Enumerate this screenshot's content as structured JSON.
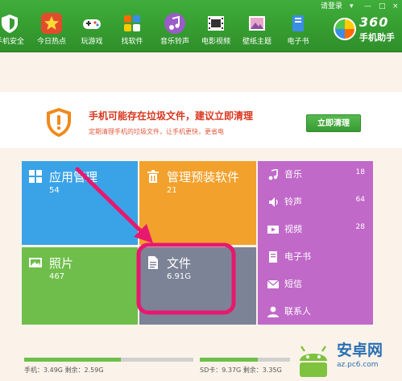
{
  "window": {
    "login": "请登录",
    "min": "—",
    "max": "□",
    "close": "×"
  },
  "nav": [
    {
      "label": "手机安全",
      "icon": "shield-icon"
    },
    {
      "label": "今日热点",
      "icon": "star-icon"
    },
    {
      "label": "玩游戏",
      "icon": "gamepad-icon"
    },
    {
      "label": "找软件",
      "icon": "apps-icon"
    },
    {
      "label": "音乐铃声",
      "icon": "music-icon"
    },
    {
      "label": "电影视频",
      "icon": "film-icon"
    },
    {
      "label": "壁纸主题",
      "icon": "wallpaper-icon"
    },
    {
      "label": "电子书",
      "icon": "book-icon"
    }
  ],
  "brand": {
    "number": "360",
    "name": "手机助手"
  },
  "alert": {
    "title": "手机可能存在垃圾文件，建议立即清理",
    "subtitle": "定期清理手机的垃圾文件，让手机更快，更省电",
    "button": "立即清理"
  },
  "tiles": {
    "apps": {
      "title": "应用管理",
      "value": "54",
      "color": "#3aa3e8"
    },
    "preinstalled": {
      "title": "管理预装软件",
      "value": "21",
      "color": "#f2a12c"
    },
    "photos": {
      "title": "照片",
      "value": "467",
      "color": "#6fbe4b"
    },
    "files": {
      "title": "文件",
      "value": "6.91G",
      "color": "#7c8397"
    }
  },
  "side": {
    "color": "#c069c8",
    "items": [
      {
        "label": "音乐",
        "count": "18",
        "icon": "music-note-icon"
      },
      {
        "label": "铃声",
        "count": "64",
        "icon": "ringtone-icon"
      },
      {
        "label": "视频",
        "count": "28",
        "icon": "video-icon"
      },
      {
        "label": "电子书",
        "count": "",
        "icon": "ebook-icon"
      },
      {
        "label": "短信",
        "count": "",
        "icon": "mail-icon"
      },
      {
        "label": "联系人",
        "count": "",
        "icon": "contact-icon"
      }
    ]
  },
  "storage": {
    "phone": {
      "text": "手机：3.49G   剩余：2.59G",
      "used_fraction": 0.57
    },
    "sd": {
      "text": "SD卡：9.37G   剩余：3.35G",
      "used_fraction": 0.64
    }
  },
  "watermark": {
    "site": "安卓网",
    "url": "az.pc6.com"
  },
  "colors": {
    "green": "#3fae3a",
    "alert_red": "#d8361d",
    "highlight": "#e8186f"
  }
}
